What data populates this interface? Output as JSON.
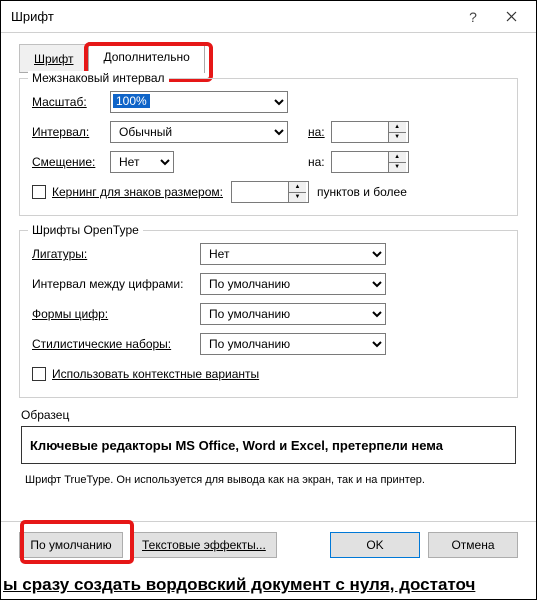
{
  "window": {
    "title": "Шрифт"
  },
  "tabs": {
    "font": "Шрифт",
    "advanced": "Дополнительно"
  },
  "spacing": {
    "group": "Межзнаковый интервал",
    "scale_lbl": "Масштаб:",
    "scale_val": "100%",
    "spacing_lbl": "Интервал:",
    "spacing_val": "Обычный",
    "position_lbl": "Смещение:",
    "position_val": "Нет",
    "na": "на:",
    "kerning": "Кернинг для знаков размером:",
    "kerning_tail": "пунктов и более"
  },
  "opentype": {
    "group": "Шрифты OpenType",
    "ligatures_lbl": "Лигатуры:",
    "ligatures_val": "Нет",
    "numspacing_lbl": "Интервал между цифрами:",
    "numspacing_val": "По умолчанию",
    "numforms_lbl": "Формы цифр:",
    "numforms_val": "По умолчанию",
    "styleset_lbl": "Стилистические наборы:",
    "styleset_val": "По умолчанию",
    "contextual": "Использовать контекстные варианты"
  },
  "preview": {
    "group": "Образец",
    "text": "Ключевые редакторы MS Office, Word и Excel, претерпели нема",
    "hint": "Шрифт TrueType. Он используется для вывода как на экран, так и на принтер."
  },
  "footer": {
    "default": "По умолчанию",
    "effects": "Текстовые эффекты...",
    "ok": "OK",
    "cancel": "Отмена"
  },
  "bg": "ы сразу создать вордовский документ с нуля, достаточ"
}
